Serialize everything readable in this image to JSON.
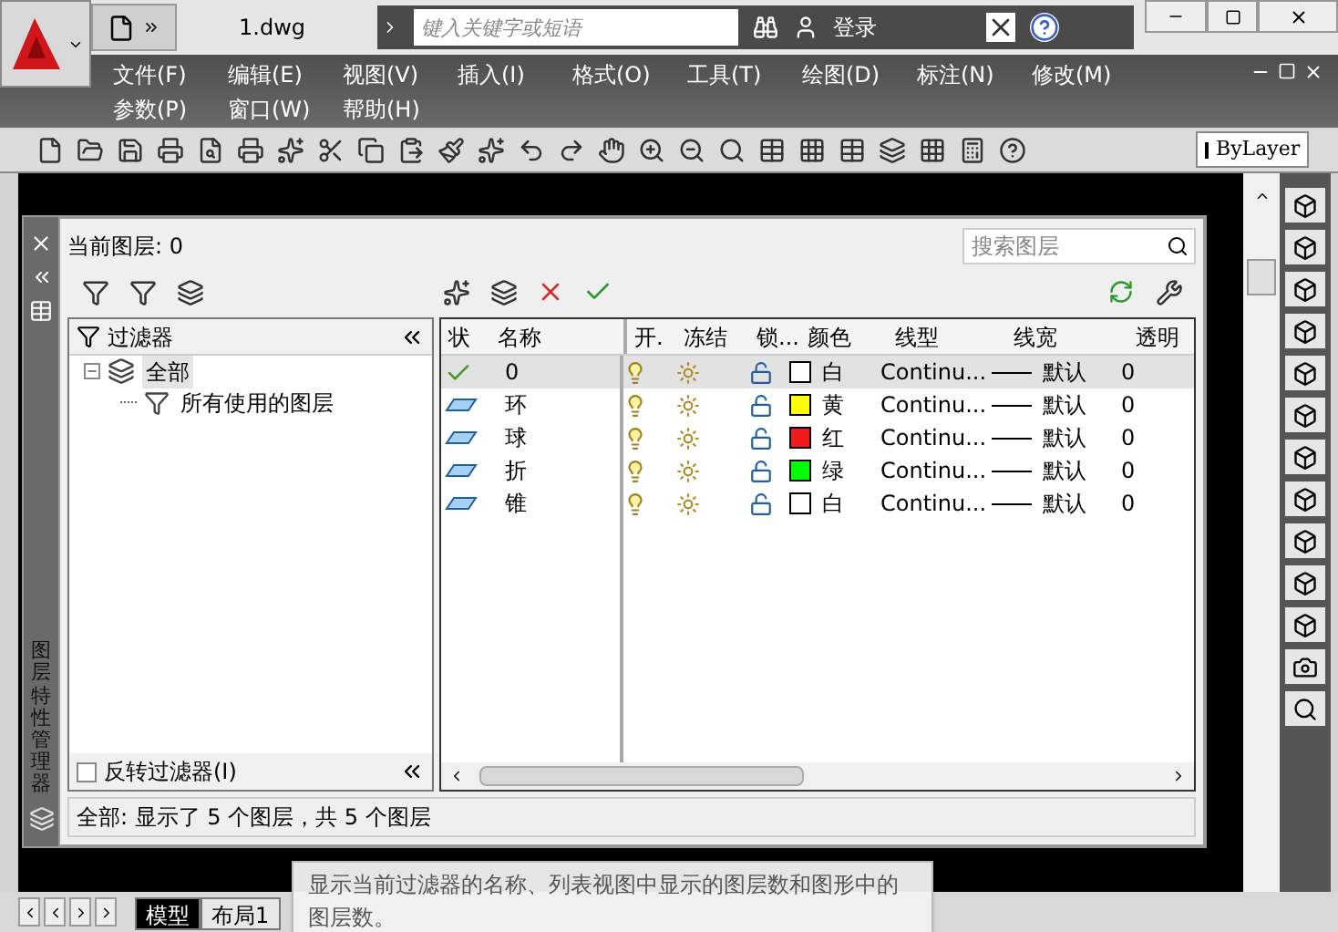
{
  "title_bar": {
    "file_tab": "1.dwg",
    "search": {
      "placeholder": "键入关键字或短语"
    },
    "login": "登录"
  },
  "menu": [
    {
      "label": "文件(F)"
    },
    {
      "label": "编辑(E)"
    },
    {
      "label": "视图(V)"
    },
    {
      "label": "插入(I)"
    },
    {
      "label": "格式(O)"
    },
    {
      "label": "工具(T)"
    },
    {
      "label": "绘图(D)"
    },
    {
      "label": "标注(N)"
    },
    {
      "label": "修改(M)"
    },
    {
      "label": "参数(P)"
    },
    {
      "label": "窗口(W)"
    },
    {
      "label": "帮助(H)"
    }
  ],
  "toolbar": {
    "layer_dropdown": "ByLayer"
  },
  "layer_manager": {
    "side_title": "图层特性管理器",
    "current_layer": "当前图层: 0",
    "search": {
      "placeholder": "搜索图层"
    },
    "filter_panel": {
      "title": "过滤器",
      "tree": [
        {
          "label": "全部",
          "selected": true,
          "expanded": true,
          "children": [
            {
              "label": "所有使用的图层",
              "selected": false
            }
          ]
        }
      ],
      "invert": {
        "label": "反转过滤器(I)",
        "checked": false
      }
    },
    "columns": [
      "状",
      "名称",
      "开.",
      "冻结",
      "锁...",
      "颜色",
      "线型",
      "线宽",
      "透明"
    ],
    "rows": [
      {
        "current": true,
        "selected": true,
        "name": "0",
        "on": true,
        "frozen": false,
        "locked": false,
        "color": "#ffffff",
        "color_name": "白",
        "linetype": "Continu...",
        "lineweight": "默认",
        "transparency": "0"
      },
      {
        "current": false,
        "selected": false,
        "name": "环",
        "on": true,
        "frozen": false,
        "locked": false,
        "color": "#ffff00",
        "color_name": "黄",
        "linetype": "Continu...",
        "lineweight": "默认",
        "transparency": "0"
      },
      {
        "current": false,
        "selected": false,
        "name": "球",
        "on": true,
        "frozen": false,
        "locked": false,
        "color": "#ee1c1c",
        "color_name": "红",
        "linetype": "Continu...",
        "lineweight": "默认",
        "transparency": "0"
      },
      {
        "current": false,
        "selected": false,
        "name": "折",
        "on": true,
        "frozen": false,
        "locked": false,
        "color": "#00ff00",
        "color_name": "绿",
        "linetype": "Continu...",
        "lineweight": "默认",
        "transparency": "0"
      },
      {
        "current": false,
        "selected": false,
        "name": "锥",
        "on": true,
        "frozen": false,
        "locked": false,
        "color": "#ffffff",
        "color_name": "白",
        "linetype": "Continu...",
        "lineweight": "默认",
        "transparency": "0"
      }
    ],
    "status": "全部: 显示了 5 个图层，共 5 个图层"
  },
  "layout_tabs": [
    {
      "label": "模型",
      "selected": true
    },
    {
      "label": "布局1",
      "selected": false
    }
  ],
  "tooltip": "显示当前过滤器的名称、列表视图中显示的图层数和图形中的图层数。"
}
